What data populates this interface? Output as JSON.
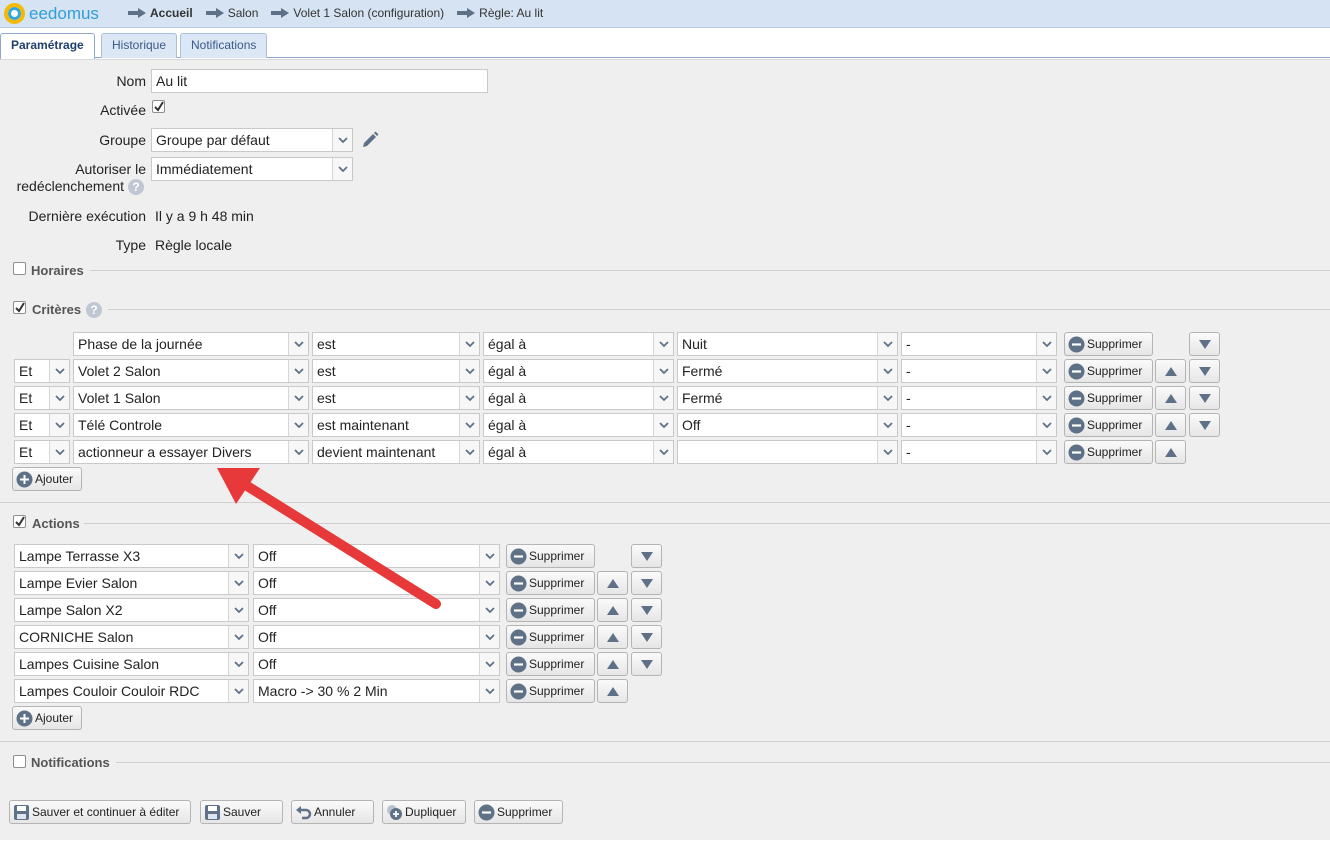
{
  "brand": {
    "name": "eedomus"
  },
  "breadcrumb": [
    "Accueil",
    "Salon",
    "Volet 1 Salon (configuration)",
    "Règle: Au lit"
  ],
  "tabs": [
    "Paramétrage",
    "Historique",
    "Notifications"
  ],
  "form": {
    "nom_label": "Nom",
    "nom_value": "Au lit",
    "activee_label": "Activée",
    "activee_checked": true,
    "groupe_label": "Groupe",
    "groupe_value": "Groupe par défaut",
    "autoriser_label_1": "Autoriser le",
    "autoriser_label_2": "redéclenchement",
    "autoriser_value": "Immédiatement",
    "derniere_label": "Dernière exécution",
    "derniere_value": "Il y a 9 h 48 min",
    "type_label": "Type",
    "type_value": "Règle locale"
  },
  "sections": {
    "horaires": "Horaires",
    "criteres": "Critères",
    "actions": "Actions",
    "notifications": "Notifications"
  },
  "criteria": [
    {
      "conj": "",
      "device": "Phase de la journée",
      "op": "est",
      "cmp": "égal à",
      "value": "Nuit",
      "extra": "-"
    },
    {
      "conj": "Et",
      "device": "Volet 2 Salon",
      "op": "est",
      "cmp": "égal à",
      "value": "Fermé",
      "extra": "-"
    },
    {
      "conj": "Et",
      "device": "Volet 1 Salon",
      "op": "est",
      "cmp": "égal à",
      "value": "Fermé",
      "extra": "-"
    },
    {
      "conj": "Et",
      "device": "Télé Controle",
      "op": "est maintenant",
      "cmp": "égal à",
      "value": "Off",
      "extra": "-"
    },
    {
      "conj": "Et",
      "device": "actionneur a essayer Divers",
      "op": "devient maintenant",
      "cmp": "égal à",
      "value": "",
      "extra": "-"
    }
  ],
  "actions": [
    {
      "device": "Lampe Terrasse X3",
      "value": "Off"
    },
    {
      "device": "Lampe Evier Salon",
      "value": "Off"
    },
    {
      "device": "Lampe Salon X2",
      "value": "Off"
    },
    {
      "device": "CORNICHE Salon",
      "value": "Off"
    },
    {
      "device": "Lampes Cuisine Salon",
      "value": "Off"
    },
    {
      "device": "Lampes Couloir Couloir RDC",
      "value": "Macro -> 30 % 2 Min"
    }
  ],
  "buttons": {
    "supprimer": "Supprimer",
    "ajouter": "Ajouter",
    "save_continue": "Sauver et continuer à éditer",
    "save": "Sauver",
    "cancel": "Annuler",
    "duplicate": "Dupliquer",
    "delete": "Supprimer"
  },
  "colors": {
    "annotation_arrow": "#e8393a",
    "topbar": "#d6e3f2",
    "brand_blue": "#2e9fd9",
    "brand_yellow": "#f6b800"
  }
}
